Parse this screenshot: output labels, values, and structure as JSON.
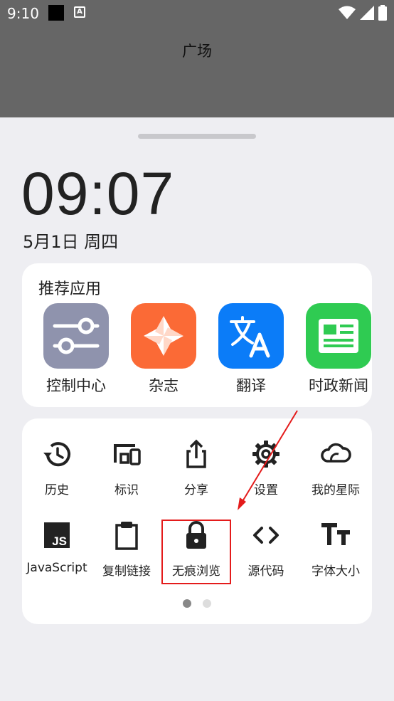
{
  "status_bar": {
    "time": "9:10",
    "notification_icon_letter": "A"
  },
  "header": {
    "title": "广场"
  },
  "clock": {
    "time": "09:07",
    "date": "5月1日 周四"
  },
  "recommended": {
    "title": "推荐应用",
    "apps": [
      {
        "label": "控制中心",
        "icon": "sliders-icon",
        "color": "#8f93ad"
      },
      {
        "label": "杂志",
        "icon": "pinwheel-icon",
        "color": "#fb6a36"
      },
      {
        "label": "翻译",
        "icon": "translate-icon",
        "color": "#0b7cf8"
      },
      {
        "label": "时政新闻",
        "icon": "news-icon",
        "color": "#2fcb52"
      }
    ]
  },
  "tools": {
    "items": [
      {
        "label": "历史",
        "icon": "history-icon"
      },
      {
        "label": "标识",
        "icon": "devices-icon"
      },
      {
        "label": "分享",
        "icon": "share-icon"
      },
      {
        "label": "设置",
        "icon": "gear-icon"
      },
      {
        "label": "我的星际",
        "icon": "cloud-icon"
      },
      {
        "label": "JavaScript",
        "icon": "js-icon"
      },
      {
        "label": "复制链接",
        "icon": "clipboard-icon"
      },
      {
        "label": "无痕浏览",
        "icon": "lock-icon"
      },
      {
        "label": "源代码",
        "icon": "code-icon"
      },
      {
        "label": "字体大小",
        "icon": "font-size-icon"
      }
    ],
    "page_count": 2,
    "current_page": 1
  },
  "annotation": {
    "highlighted_item": "无痕浏览",
    "color": "#e41b1b"
  }
}
